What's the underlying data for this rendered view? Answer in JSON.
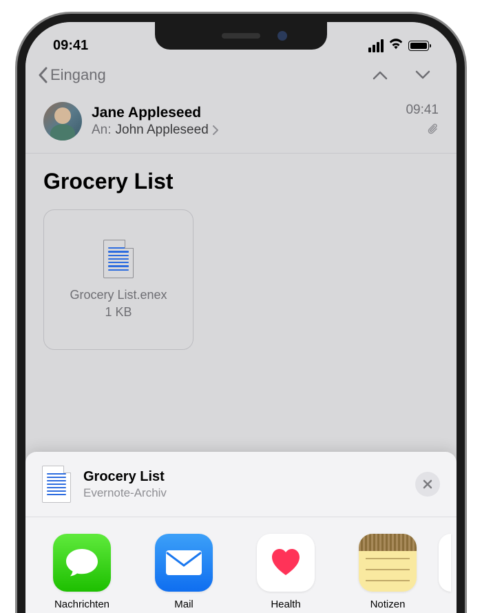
{
  "status": {
    "time": "09:41"
  },
  "nav": {
    "back_label": "Eingang"
  },
  "message": {
    "sender": "Jane Appleseed",
    "to_label": "An:",
    "recipient": "John Appleseed",
    "time": "09:41",
    "subject": "Grocery List"
  },
  "attachment": {
    "filename": "Grocery List.enex",
    "size": "1 KB"
  },
  "sheet": {
    "title": "Grocery List",
    "subtitle": "Evernote-Archiv",
    "apps": [
      {
        "label": "Nachrichten"
      },
      {
        "label": "Mail"
      },
      {
        "label": "Health"
      },
      {
        "label": "Notizen"
      }
    ]
  }
}
